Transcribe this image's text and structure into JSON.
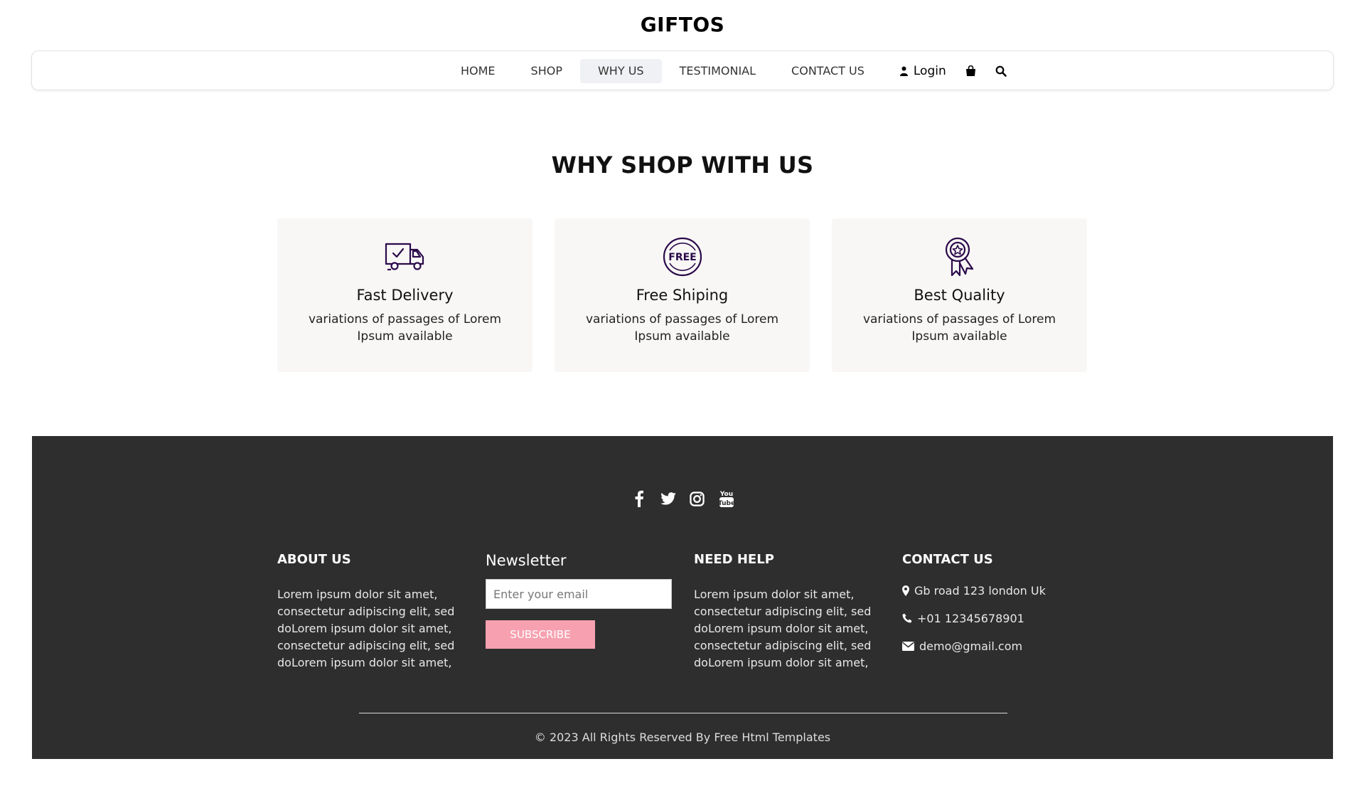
{
  "brand": "GIFTOS",
  "nav": {
    "items": [
      {
        "label": "HOME"
      },
      {
        "label": "SHOP"
      },
      {
        "label": "WHY US"
      },
      {
        "label": "TESTIMONIAL"
      },
      {
        "label": "CONTACT US"
      }
    ],
    "active": "WHY US",
    "login": "Login"
  },
  "why": {
    "title": "WHY SHOP WITH US",
    "cards": [
      {
        "icon": "delivery-truck-icon",
        "title": "Fast Delivery",
        "text": "variations of passages of Lorem Ipsum available"
      },
      {
        "icon": "free-badge-icon",
        "title": "Free Shiping",
        "text": "variations of passages of Lorem Ipsum available"
      },
      {
        "icon": "quality-ribbon-icon",
        "title": "Best Quality",
        "text": "variations of passages of Lorem Ipsum available"
      }
    ]
  },
  "footer": {
    "social": [
      "facebook-icon",
      "twitter-icon",
      "instagram-icon",
      "youtube-icon"
    ],
    "about": {
      "heading": "ABOUT US",
      "text": "Lorem ipsum dolor sit amet, consectetur adipiscing elit, sed doLorem ipsum dolor sit amet, consectetur adipiscing elit, sed doLorem ipsum dolor sit amet,"
    },
    "newsletter": {
      "heading": "Newsletter",
      "placeholder": "Enter your email",
      "button": "SUBSCRIBE"
    },
    "help": {
      "heading": "NEED HELP",
      "text": "Lorem ipsum dolor sit amet, consectetur adipiscing elit, sed doLorem ipsum dolor sit amet, consectetur adipiscing elit, sed doLorem ipsum dolor sit amet,"
    },
    "contact": {
      "heading": "CONTACT US",
      "address": "Gb road 123 london Uk",
      "phone": "+01 12345678901",
      "email": "demo@gmail.com"
    },
    "copyright": "© 2023 All Rights Reserved By Free Html Templates"
  },
  "colors": {
    "icon_purple": "#2b0a4a",
    "footer_bg": "#2e2e2e",
    "subscribe_bg": "#f7a1b0",
    "card_bg": "#f8f7f6"
  }
}
